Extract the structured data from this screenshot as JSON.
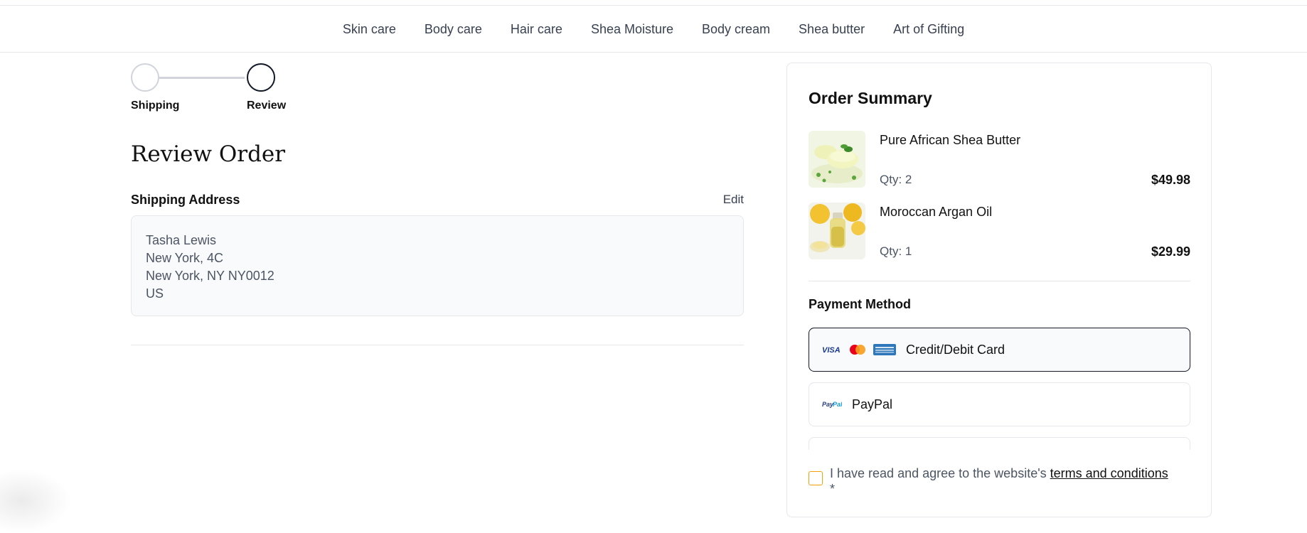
{
  "nav": {
    "items": [
      "Skin care",
      "Body care",
      "Hair care",
      "Shea Moisture",
      "Body cream",
      "Shea butter",
      "Art of Gifting"
    ]
  },
  "stepper": {
    "steps": [
      "Shipping",
      "Review"
    ]
  },
  "review": {
    "title": "Review Order",
    "shipping_heading": "Shipping Address",
    "edit_label": "Edit",
    "address_lines": [
      "Tasha Lewis",
      "New York, 4C",
      "New York, NY NY0012",
      "US"
    ]
  },
  "summary": {
    "title": "Order Summary",
    "items": [
      {
        "name": "Pure African Shea Butter",
        "qty": "Qty: 2",
        "price": "$49.98"
      },
      {
        "name": "Moroccan Argan Oil",
        "qty": "Qty: 1",
        "price": "$29.99"
      }
    ],
    "payment_heading": "Payment Method",
    "payment_options": [
      {
        "label": "Credit/Debit Card",
        "icons": [
          "visa-icon",
          "mastercard-icon",
          "amex-icon"
        ],
        "selected": true
      },
      {
        "label": "PayPal",
        "icons": [
          "paypal-icon"
        ],
        "selected": false
      }
    ],
    "terms_prefix": "I have read and agree to the website's ",
    "terms_link": "terms and conditions",
    "terms_required": "*"
  },
  "colors": {
    "accent": "#111827",
    "checkbox_border": "#f59e0b",
    "border": "#e5e7eb",
    "muted_text": "#4b5563"
  }
}
